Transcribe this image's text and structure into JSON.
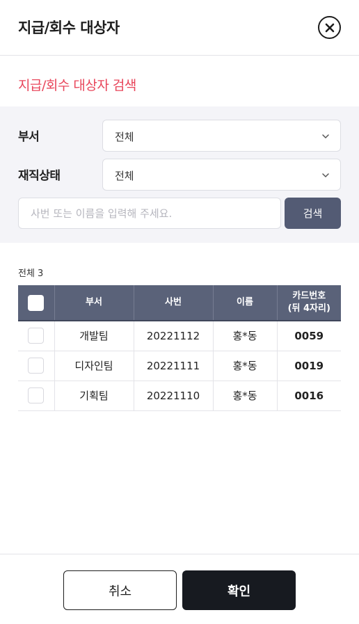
{
  "header": {
    "title": "지급/회수 대상자",
    "close_icon": "close-icon"
  },
  "search": {
    "section_title": "지급/회수 대상자 검색",
    "department_label": "부서",
    "department_value": "전체",
    "status_label": "재직상태",
    "status_value": "전체",
    "keyword_placeholder": "사번 또는 이름을 입력해 주세요.",
    "keyword_value": "",
    "search_button": "검색",
    "accent_color": "#e8455a"
  },
  "results": {
    "total_label": "전체 3",
    "columns": [
      "부서",
      "사번",
      "이름",
      "카드번호",
      "(뒤 4자리)"
    ],
    "rows": [
      {
        "department": "개발팀",
        "employee_id": "20221112",
        "name": "홍*동",
        "card": "0059"
      },
      {
        "department": "디자인팀",
        "employee_id": "20221111",
        "name": "홍*동",
        "card": "0019"
      },
      {
        "department": "기획팀",
        "employee_id": "20221110",
        "name": "홍*동",
        "card": "0016"
      }
    ]
  },
  "footer": {
    "cancel_label": "취소",
    "confirm_label": "확인"
  }
}
